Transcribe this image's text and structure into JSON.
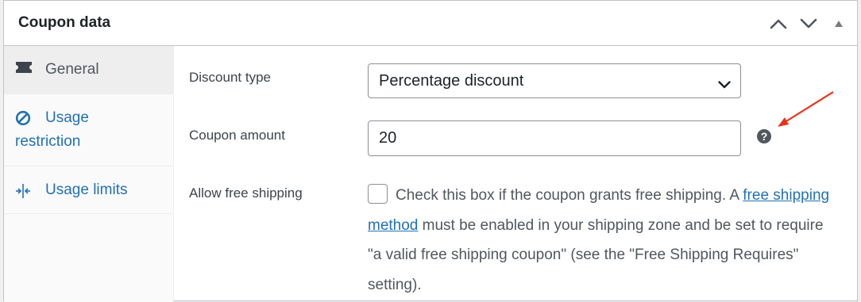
{
  "panel": {
    "title": "Coupon data"
  },
  "header_controls": [
    {
      "name": "move-up-icon"
    },
    {
      "name": "move-down-icon"
    },
    {
      "name": "toggle-arrow-icon"
    }
  ],
  "tabs": [
    {
      "label": "General",
      "icon": "ticket-icon",
      "active": true
    },
    {
      "label_1": "Usage",
      "label_2": "restriction",
      "icon": "ban-icon",
      "active": false
    },
    {
      "label": "Usage limits",
      "icon": "limits-icon",
      "active": false
    }
  ],
  "fields": {
    "discount_type": {
      "label": "Discount type",
      "value": "Percentage discount"
    },
    "coupon_amount": {
      "label": "Coupon amount",
      "value": "20"
    },
    "free_shipping": {
      "label": "Allow free shipping",
      "checked": false,
      "desc_before": "Check this box if the coupon grants free shipping. A ",
      "link": "free shipping method",
      "desc_after": " must be enabled in your shipping zone and be set to require \"a valid free shipping coupon\" (see the \"Free Shipping Requires\" setting)."
    }
  },
  "colors": {
    "link": "#2271b1",
    "annotation_arrow": "#e8311a",
    "border": "#c3c4c7"
  }
}
